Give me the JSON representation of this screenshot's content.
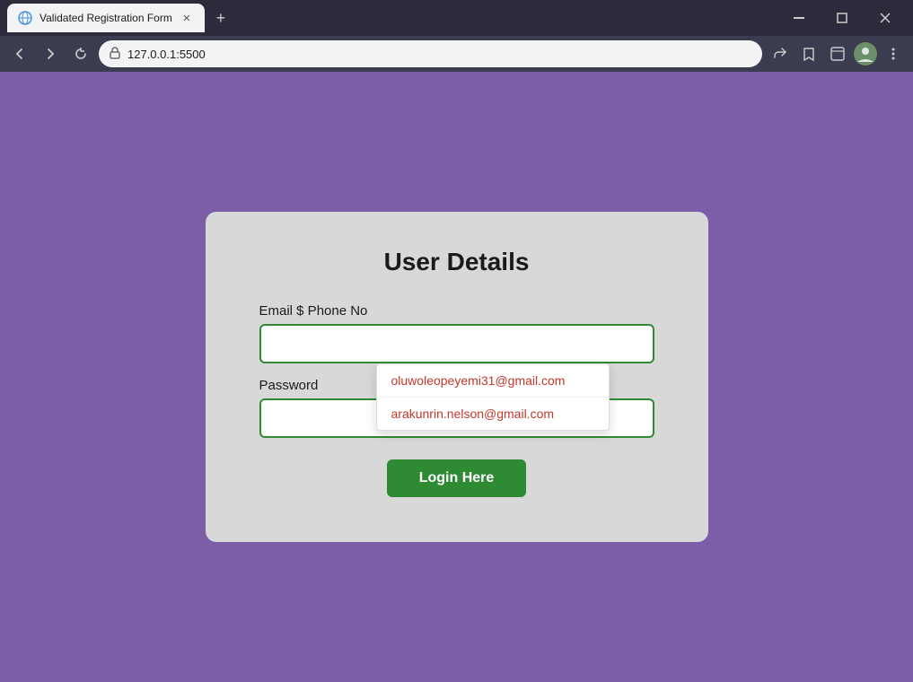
{
  "browser": {
    "tab_title": "Validated Registration Form",
    "url": "127.0.0.1:5500",
    "new_tab_label": "+",
    "win_minimize": "—",
    "win_restore": "❐",
    "win_close": "✕"
  },
  "nav": {
    "back_label": "‹",
    "forward_label": "›",
    "reload_label": "↻",
    "lock_icon": "🔒",
    "url_text": "127.0.0.1:5500"
  },
  "form": {
    "title": "User Details",
    "email_label": "Email $ Phone No",
    "email_placeholder": "",
    "password_label": "Password",
    "password_placeholder": "",
    "login_button": "Login Here",
    "autocomplete": {
      "items": [
        {
          "id": "ac1",
          "text": "oluwoleopeyemi31@gmail.com"
        },
        {
          "id": "ac2",
          "text": "arakunrin.nelson@gmail.com"
        }
      ]
    }
  }
}
